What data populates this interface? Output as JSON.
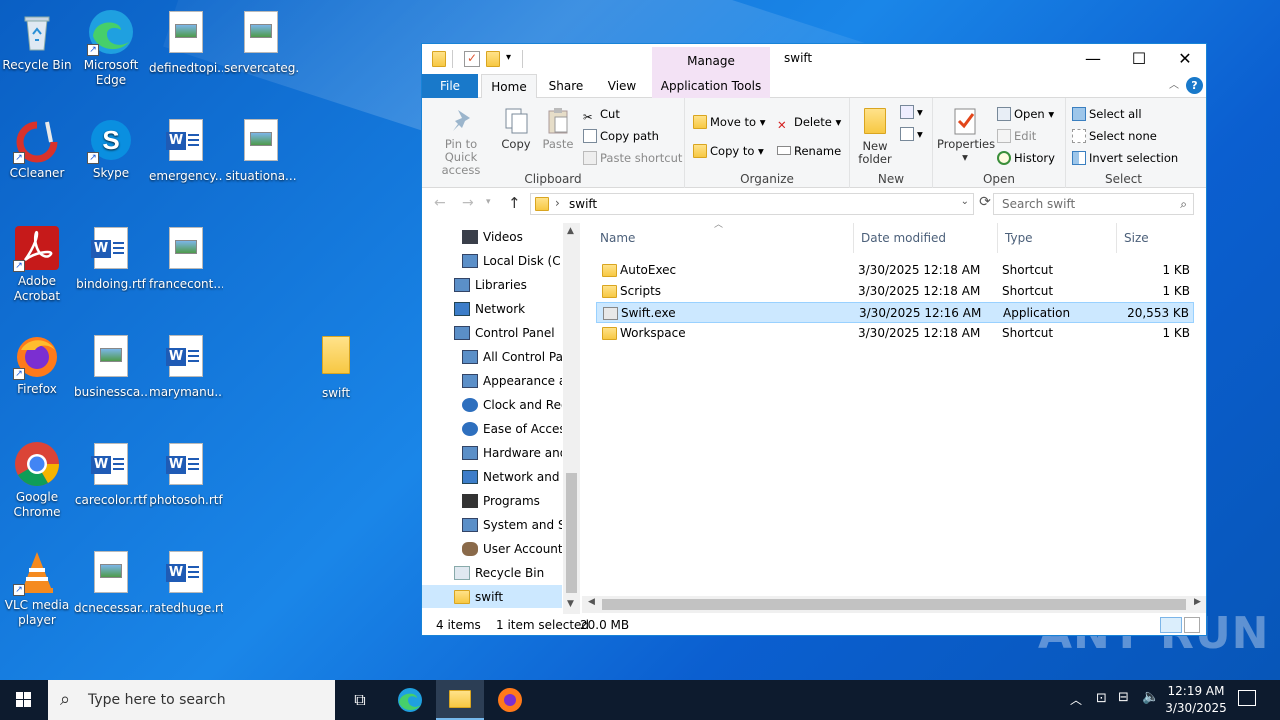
{
  "desktop": {
    "icons": [
      {
        "label": "Recycle Bin",
        "icon": "recycle-bin-icon"
      },
      {
        "label": "Microsoft Edge",
        "icon": "edge-icon"
      },
      {
        "label": "definedtopi...",
        "icon": "image-file-icon"
      },
      {
        "label": "servercateg...",
        "icon": "image-file-icon"
      },
      {
        "label": "CCleaner",
        "icon": "ccleaner-icon"
      },
      {
        "label": "Skype",
        "icon": "skype-icon"
      },
      {
        "label": "emergency...",
        "icon": "word-doc-icon"
      },
      {
        "label": "situationa...",
        "icon": "image-file-icon"
      },
      {
        "label": "Adobe Acrobat",
        "icon": "acrobat-icon"
      },
      {
        "label": "bindoing.rtf",
        "icon": "word-doc-icon"
      },
      {
        "label": "francecont...",
        "icon": "image-file-icon"
      },
      {
        "label": "Firefox",
        "icon": "firefox-icon"
      },
      {
        "label": "businessca...",
        "icon": "image-file-icon"
      },
      {
        "label": "marymanu...",
        "icon": "word-doc-icon"
      },
      {
        "label": "swift",
        "icon": "folder-icon"
      },
      {
        "label": "Google Chrome",
        "icon": "chrome-icon"
      },
      {
        "label": "carecolor.rtf",
        "icon": "word-doc-icon"
      },
      {
        "label": "photosoh.rtf",
        "icon": "word-doc-icon"
      },
      {
        "label": "VLC media player",
        "icon": "vlc-icon"
      },
      {
        "label": "dcnecessar...",
        "icon": "image-file-icon"
      },
      {
        "label": "ratedhuge.rtf",
        "icon": "word-doc-icon"
      }
    ]
  },
  "explorer": {
    "title": "swift",
    "context_tab": "Manage",
    "window_controls": {
      "minimize": "—",
      "maximize": "☐",
      "close": "✕"
    },
    "tabs": {
      "file": "File",
      "home": "Home",
      "share": "Share",
      "view": "View",
      "app_tools": "Application Tools"
    },
    "ribbon": {
      "clipboard": {
        "label": "Clipboard",
        "pin": "Pin to Quick access",
        "copy": "Copy",
        "paste": "Paste",
        "cut": "Cut",
        "copy_path": "Copy path",
        "paste_shortcut": "Paste shortcut"
      },
      "organize": {
        "label": "Organize",
        "move_to": "Move to",
        "copy_to": "Copy to",
        "delete": "Delete",
        "rename": "Rename"
      },
      "new": {
        "label": "New",
        "new_folder": "New folder"
      },
      "open": {
        "label": "Open",
        "properties": "Properties",
        "open": "Open",
        "edit": "Edit",
        "history": "History"
      },
      "select": {
        "label": "Select",
        "select_all": "Select all",
        "select_none": "Select none",
        "invert": "Invert selection"
      }
    },
    "address": {
      "path": "swift",
      "search_placeholder": "Search swift"
    },
    "nav": [
      {
        "label": "Videos",
        "icon": "videos-icon"
      },
      {
        "label": "Local Disk (C:)",
        "icon": "drive-icon"
      },
      {
        "label": "Libraries",
        "icon": "libraries-icon"
      },
      {
        "label": "Network",
        "icon": "network-icon"
      },
      {
        "label": "Control Panel",
        "icon": "control-panel-icon"
      },
      {
        "label": "All Control Panel Items",
        "icon": "control-panel-icon"
      },
      {
        "label": "Appearance and Personalization",
        "icon": "appearance-icon"
      },
      {
        "label": "Clock and Region",
        "icon": "clock-icon"
      },
      {
        "label": "Ease of Access",
        "icon": "ease-access-icon"
      },
      {
        "label": "Hardware and Sound",
        "icon": "hardware-icon"
      },
      {
        "label": "Network and Internet",
        "icon": "network-internet-icon"
      },
      {
        "label": "Programs",
        "icon": "programs-icon"
      },
      {
        "label": "System and Security",
        "icon": "system-security-icon"
      },
      {
        "label": "User Accounts",
        "icon": "user-accounts-icon"
      },
      {
        "label": "Recycle Bin",
        "icon": "recycle-bin-icon"
      },
      {
        "label": "swift",
        "icon": "folder-icon"
      }
    ],
    "columns": {
      "name": "Name",
      "date": "Date modified",
      "type": "Type",
      "size": "Size"
    },
    "files": [
      {
        "name": "AutoExec",
        "date": "3/30/2025 12:18 AM",
        "type": "Shortcut",
        "size": "1 KB"
      },
      {
        "name": "Scripts",
        "date": "3/30/2025 12:18 AM",
        "type": "Shortcut",
        "size": "1 KB"
      },
      {
        "name": "Swift.exe",
        "date": "3/30/2025 12:16 AM",
        "type": "Application",
        "size": "20,553 KB"
      },
      {
        "name": "Workspace",
        "date": "3/30/2025 12:18 AM",
        "type": "Shortcut",
        "size": "1 KB"
      }
    ],
    "selected_index": 2,
    "status": {
      "items": "4 items",
      "selected": "1 item selected",
      "size": "20.0 MB"
    }
  },
  "taskbar": {
    "search_placeholder": "Type here to search",
    "time": "12:19 AM",
    "date": "3/30/2025"
  },
  "watermark": "ANY RUN",
  "colors": {
    "accent": "#1979ca",
    "selection": "#cce8ff",
    "manage_tab": "#f3e2f5",
    "taskbar": "#0d1b2e"
  }
}
